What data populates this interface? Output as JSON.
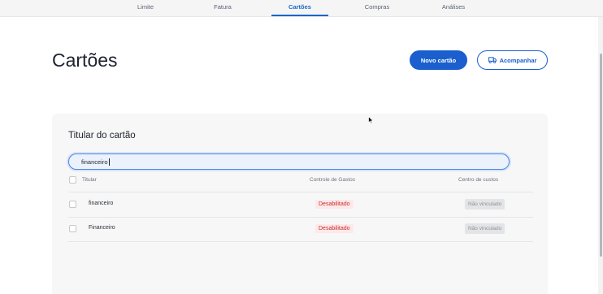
{
  "tabs": [
    {
      "label": "Limite"
    },
    {
      "label": "Fatura"
    },
    {
      "label": "Cartões"
    },
    {
      "label": "Compras"
    },
    {
      "label": "Análises"
    }
  ],
  "header": {
    "title": "Cartões",
    "new_card_label": "Novo cartão",
    "track_label": "Acompanhar"
  },
  "panel": {
    "title": "Titular do cartão",
    "search": {
      "value": "financeiro"
    },
    "columns": {
      "holder": "Titular",
      "spend_control": "Controle de Gastos",
      "cost_center": "Centro de custos"
    },
    "rows": [
      {
        "name": "financeiro",
        "spend_control": "Desabilitado",
        "cost_center": "Não vinculado"
      },
      {
        "name": "Financeiro",
        "spend_control": "Desabilitado",
        "cost_center": "Não vinculado"
      }
    ]
  },
  "colors": {
    "accent": "#1a5fcd",
    "disabled_text": "#cc2a2a",
    "neutral_badge": "#e3e4e6"
  }
}
